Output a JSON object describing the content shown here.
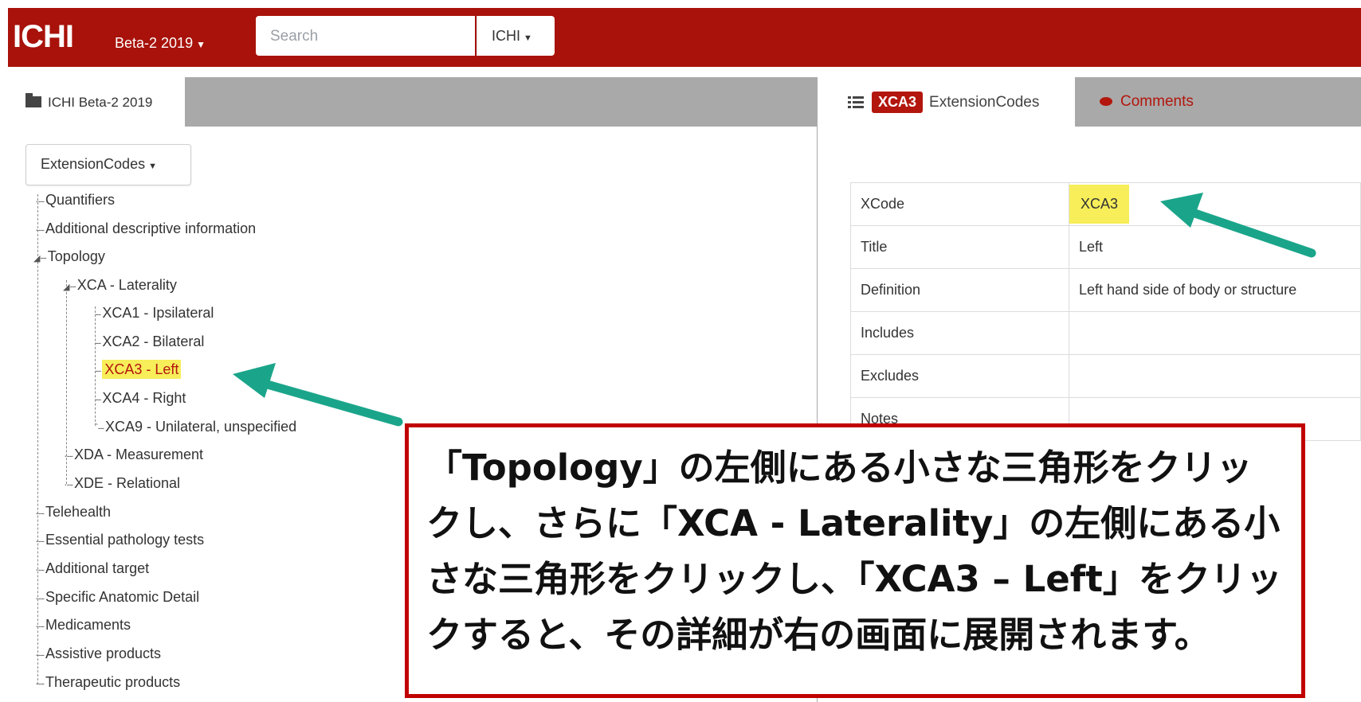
{
  "header": {
    "brand": "ICHI",
    "version_label": "Beta-2 2019",
    "search_placeholder": "Search",
    "scope_label": "ICHI"
  },
  "left_panel": {
    "tab_label": "ICHI Beta-2 2019",
    "dropdown_label": "ExtensionCodes",
    "tree": [
      {
        "label": "Quantifiers"
      },
      {
        "label": "Additional descriptive information"
      },
      {
        "label": "Topology"
      },
      {
        "label": "XCA - Laterality"
      },
      {
        "label": "XCA1 - Ipsilateral"
      },
      {
        "label": "XCA2 - Bilateral"
      },
      {
        "label": "XCA3 - Left",
        "selected": true
      },
      {
        "label": "XCA4 - Right"
      },
      {
        "label": "XCA9 - Unilateral, unspecified"
      },
      {
        "label": "XDA - Measurement"
      },
      {
        "label": "XDE - Relational"
      },
      {
        "label": "Telehealth"
      },
      {
        "label": "Essential pathology tests"
      },
      {
        "label": "Additional target"
      },
      {
        "label": "Specific Anatomic Detail"
      },
      {
        "label": "Medicaments"
      },
      {
        "label": "Assistive products"
      },
      {
        "label": "Therapeutic products"
      }
    ]
  },
  "right_panel": {
    "code_badge": "XCA3",
    "tab_label": "ExtensionCodes",
    "comments_label": "Comments",
    "rows": [
      {
        "key": "XCode",
        "value": "XCA3"
      },
      {
        "key": "Title",
        "value": "Left"
      },
      {
        "key": "Definition",
        "value": "Left hand side of body or structure"
      },
      {
        "key": "Includes",
        "value": ""
      },
      {
        "key": "Excludes",
        "value": ""
      },
      {
        "key": "Notes",
        "value": ""
      }
    ]
  },
  "callout": {
    "text": "「Topology」の左側にある小さな三角形をクリックし、さらに「XCA - Laterality」の左側にある小さな三角形をクリックし、「XCA3 – Left」をクリックすると、その詳細が右の画面に展開されます。"
  },
  "colors": {
    "header_bg": "#a8120a",
    "accent_red": "#b3160d",
    "highlight_yellow": "#f7ee5a",
    "arrow_teal": "#1aa58a",
    "callout_border": "#c00000"
  },
  "icons": {
    "folder": "folder-icon",
    "list": "list-icon",
    "comment": "comment-icon",
    "caret": "caret-down-icon",
    "tree_expanded": "triangle-down-icon"
  }
}
